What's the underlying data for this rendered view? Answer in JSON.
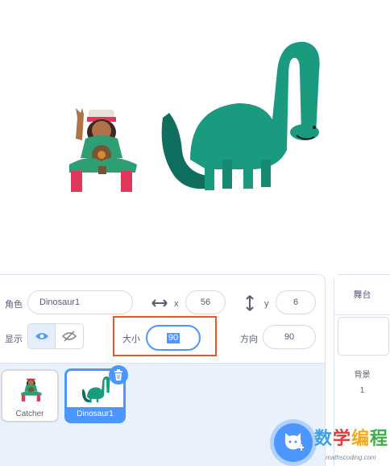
{
  "sprite_info": {
    "sprite_label": "角色",
    "sprite_name": "Dinosaur1",
    "x_label": "x",
    "x_value": "56",
    "y_label": "y",
    "y_value": "6",
    "show_label": "显示",
    "size_label": "大小",
    "size_value": "90",
    "direction_label": "方向",
    "direction_value": "90"
  },
  "sprites": [
    {
      "name": "Catcher",
      "selected": false
    },
    {
      "name": "Dinosaur1",
      "selected": true
    }
  ],
  "stage_panel": {
    "title": "舞台",
    "backdrop_label": "背景",
    "backdrop_count": "1"
  },
  "watermark": {
    "text": "数学编程",
    "url": "mathscoding.com"
  },
  "colors": {
    "accent": "#4c97ff",
    "highlight": "#e8562a",
    "dinosaur": "#1a9b80"
  },
  "icons": [
    "horizontal-arrow-icon",
    "vertical-arrow-icon",
    "eye-icon",
    "eye-slash-icon",
    "trash-icon",
    "add-sprite-cat-icon"
  ]
}
